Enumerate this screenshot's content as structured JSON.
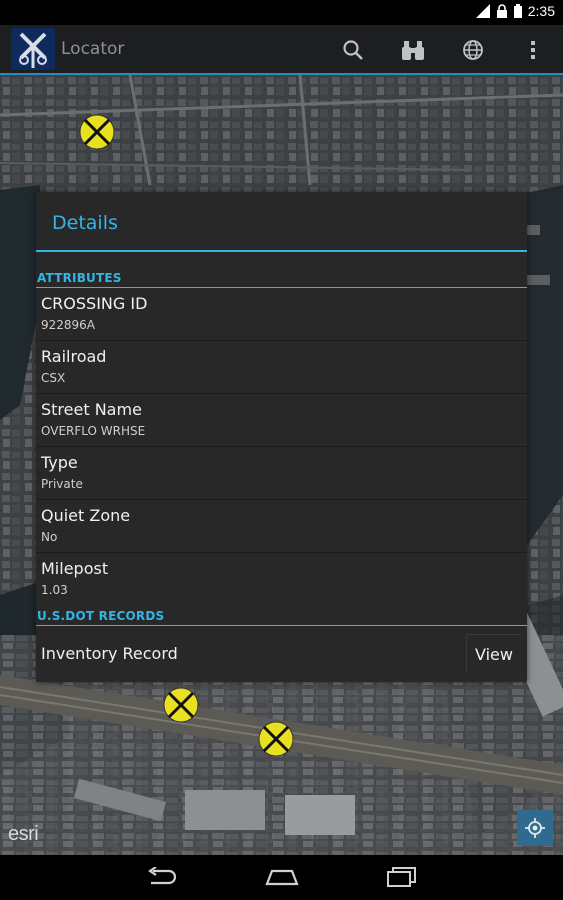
{
  "status_bar": {
    "time": "2:35"
  },
  "action_bar": {
    "title": "Locator",
    "icons": [
      "search-icon",
      "binoculars-icon",
      "globe-icon",
      "overflow-menu-icon"
    ]
  },
  "map": {
    "attribution": "esri"
  },
  "dialog": {
    "title": "Details",
    "attributes_header": "ATTRIBUTES",
    "attributes": [
      {
        "label": "CROSSING ID",
        "value": "922896A"
      },
      {
        "label": "Railroad",
        "value": "CSX"
      },
      {
        "label": "Street Name",
        "value": "OVERFLO WRHSE"
      },
      {
        "label": "Type",
        "value": "Private"
      },
      {
        "label": "Quiet Zone",
        "value": "No"
      },
      {
        "label": "Milepost",
        "value": "1.03"
      }
    ],
    "records_header": "U.S.DOT RECORDS",
    "inventory": {
      "label": "Inventory Record",
      "button": "View"
    }
  },
  "colors": {
    "accent": "#33b5e5",
    "dialog_bg": "#282828",
    "marker": "#e8e020"
  }
}
